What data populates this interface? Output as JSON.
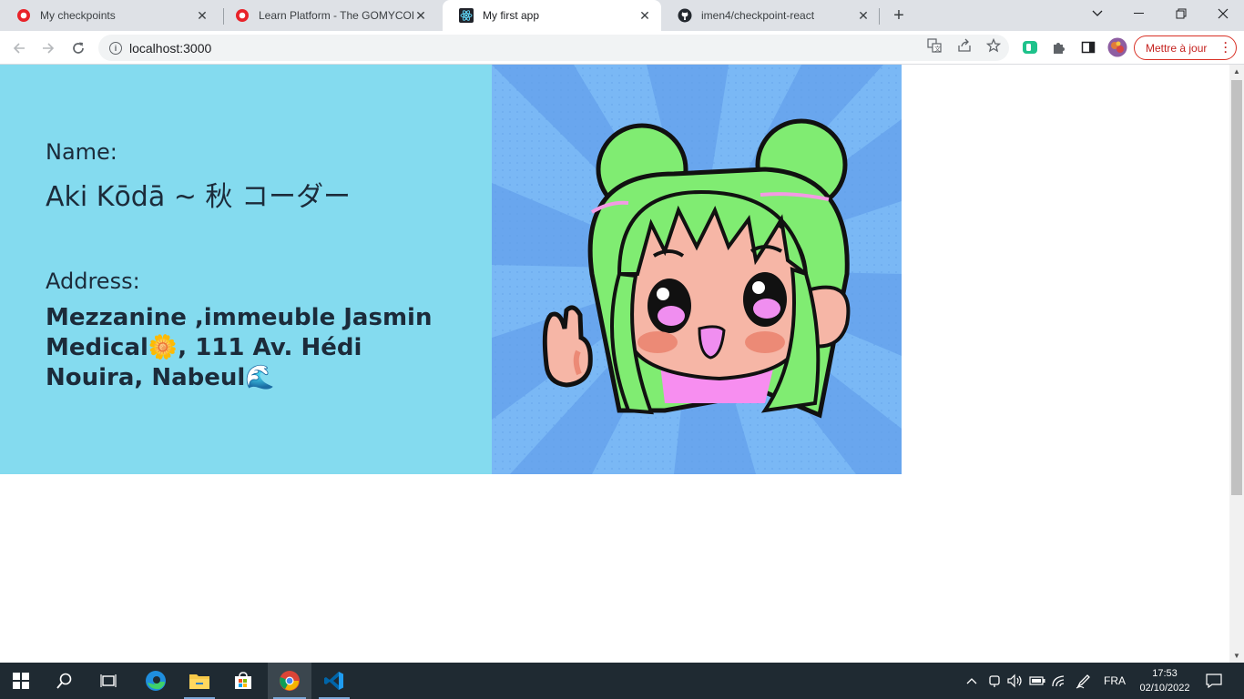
{
  "browser": {
    "tabs": [
      {
        "title": "My checkpoints",
        "favicon": "gomycode-icon",
        "active": false
      },
      {
        "title": "Learn Platform - The GOMYCODE",
        "favicon": "gomycode-icon",
        "active": false
      },
      {
        "title": "My first app",
        "favicon": "react-icon",
        "active": true
      },
      {
        "title": "imen4/checkpoint-react",
        "favicon": "github-icon",
        "active": false
      }
    ],
    "url": "localhost:3000",
    "update_button": "Mettre à jour"
  },
  "page": {
    "name_label": "Name:",
    "name_value": "Aki Kōdā ~ 秋 コーダー",
    "address_label": "Address:",
    "address_value": "Mezzanine ,immeuble Jasmin Medical🌼, 111 Av. Hédi Nouira, Nabeul🌊",
    "colors": {
      "card_bg": "#84dbef",
      "text": "#1c2b3a",
      "image_bg": "#7ab8f5"
    }
  },
  "taskbar": {
    "language": "FRA",
    "time": "17:53",
    "date": "02/10/2022"
  }
}
